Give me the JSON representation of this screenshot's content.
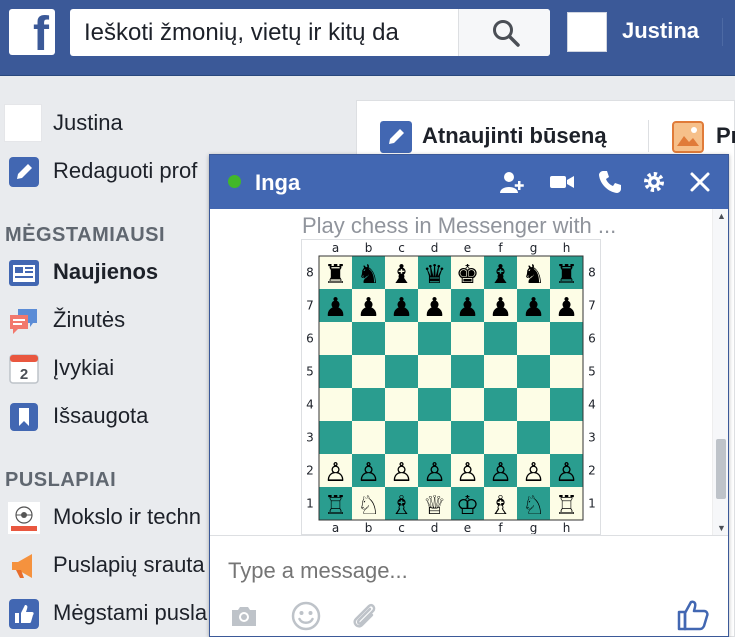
{
  "topbar": {
    "logo": "f",
    "search_value": "Ieškoti žmonių, vietų ir kitų da",
    "user_name": "Justina"
  },
  "sidebar": {
    "profile_name": "Justina",
    "edit_profile": "Redaguoti prof",
    "favorites_title": "MĖGSTAMIAUSI",
    "favorites": [
      {
        "label": "Naujienos",
        "icon": "news-feed-icon",
        "bold": true
      },
      {
        "label": "Žinutės",
        "icon": "messages-icon",
        "bold": false
      },
      {
        "label": "Įvykiai",
        "icon": "calendar-icon",
        "bold": false
      },
      {
        "label": "Išsaugota",
        "icon": "bookmark-icon",
        "bold": false
      }
    ],
    "calendar_day": "2",
    "pages_title": "PUSLAPIAI",
    "pages": [
      {
        "label": "Mokslo ir techn",
        "icon": "page-logo-icon"
      },
      {
        "label": "Puslapių srauta",
        "icon": "megaphone-icon"
      },
      {
        "label": "Mėgstami pusla",
        "icon": "like-icon"
      }
    ]
  },
  "composer": {
    "update_status": "Atnaujinti būseną",
    "photo_tab": "Pr"
  },
  "chat": {
    "contact_name": "Inga",
    "message_text": "Play chess in Messenger with ...",
    "input_placeholder": "Type a message...",
    "board": {
      "files": [
        "a",
        "b",
        "c",
        "d",
        "e",
        "f",
        "g",
        "h"
      ],
      "ranks": [
        "8",
        "7",
        "6",
        "5",
        "4",
        "3",
        "2",
        "1"
      ],
      "light_color": "#fdfde6",
      "dark_color": "#2a9d8f",
      "position": [
        [
          "♜",
          "♞",
          "♝",
          "♛",
          "♚",
          "♝",
          "♞",
          "♜"
        ],
        [
          "♟",
          "♟",
          "♟",
          "♟",
          "♟",
          "♟",
          "♟",
          "♟"
        ],
        [
          "",
          "",
          "",
          "",
          "",
          "",
          "",
          ""
        ],
        [
          "",
          "",
          "",
          "",
          "",
          "",
          "",
          ""
        ],
        [
          "",
          "",
          "",
          "",
          "",
          "",
          "",
          ""
        ],
        [
          "",
          "",
          "",
          "",
          "",
          "",
          "",
          ""
        ],
        [
          "♙",
          "♙",
          "♙",
          "♙",
          "♙",
          "♙",
          "♙",
          "♙"
        ],
        [
          "♖",
          "♘",
          "♗",
          "♕",
          "♔",
          "♗",
          "♘",
          "♖"
        ]
      ]
    }
  },
  "colors": {
    "brand": "#3b5998",
    "chat_header": "#4267b2",
    "online": "#42b72a"
  }
}
